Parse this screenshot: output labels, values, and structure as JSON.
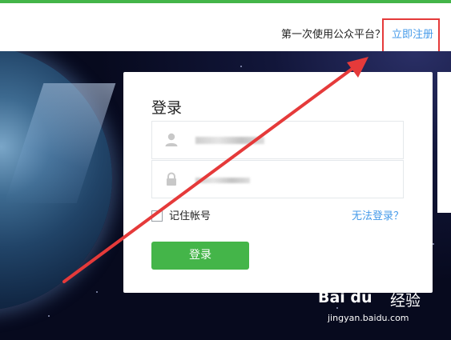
{
  "header": {
    "prompt": "第一次使用公众平台？",
    "register_link": "立即注册"
  },
  "login": {
    "title": "登录",
    "remember_label": "记住帐号",
    "cant_login_link": "无法登录？",
    "submit_label": "登录"
  },
  "watermark": {
    "logo": "Bai du",
    "label": "经验",
    "url": "jingyan.baidu.com"
  },
  "colors": {
    "brand_green": "#44b549",
    "link_blue": "#459ae9",
    "highlight_red": "#e53a3a"
  },
  "icons": {
    "user": "user-icon",
    "password": "lock-icon"
  }
}
